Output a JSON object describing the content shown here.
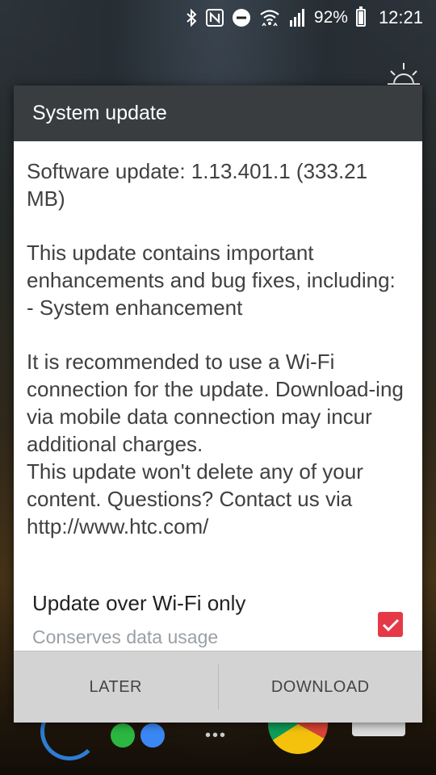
{
  "status_bar": {
    "battery": "92%",
    "time": "12:21",
    "icons": [
      "bluetooth-icon",
      "nfc-icon",
      "do-not-disturb-icon",
      "wifi-icon",
      "signal-icon",
      "battery-icon"
    ],
    "battery_level": 0.92
  },
  "dialog": {
    "title": "System update",
    "version_text": "Software update: 1.13.401.1 (333.21 MB)",
    "description": "This update contains important enhancements and bug fixes, including:\n- System enhancement",
    "recommendation": "It is recommended to use a Wi-Fi connection for the update. Download-ing via mobile data connection may incur additional charges.\nThis update won't delete any of your content. Questions? Contact us via http://www.htc.com/",
    "option": {
      "title": "Update over Wi-Fi only",
      "subtitle": "Conserves data usage",
      "checked": true
    },
    "buttons": {
      "later": "LATER",
      "download": "DOWNLOAD"
    }
  },
  "colors": {
    "accent": "#e53948",
    "header_bg": "#3a3d40",
    "button_bar_bg": "#d3d3d3"
  }
}
